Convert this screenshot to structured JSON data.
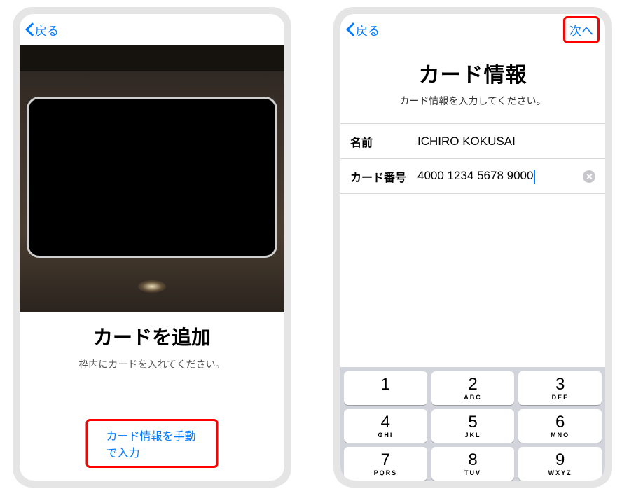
{
  "colors": {
    "ios_blue": "#007aff",
    "highlight_red": "#ff0000"
  },
  "screen1": {
    "back_label": "戻る",
    "title": "カードを追加",
    "subtitle": "枠内にカードを入れてください。",
    "manual_entry_label": "カード情報を手動で入力"
  },
  "screen2": {
    "back_label": "戻る",
    "next_label": "次へ",
    "title": "カード情報",
    "subtitle": "カード情報を入力してください。",
    "name_label": "名前",
    "name_value": "ICHIRO KOKUSAI",
    "card_number_label": "カード番号",
    "card_number_value": "4000 1234 5678 9000",
    "clear_icon": "close-circle-icon"
  },
  "keypad": [
    {
      "num": "1",
      "sub": ""
    },
    {
      "num": "2",
      "sub": "ABC"
    },
    {
      "num": "3",
      "sub": "DEF"
    },
    {
      "num": "4",
      "sub": "GHI"
    },
    {
      "num": "5",
      "sub": "JKL"
    },
    {
      "num": "6",
      "sub": "MNO"
    },
    {
      "num": "7",
      "sub": "PQRS"
    },
    {
      "num": "8",
      "sub": "TUV"
    },
    {
      "num": "9",
      "sub": "WXYZ"
    }
  ]
}
